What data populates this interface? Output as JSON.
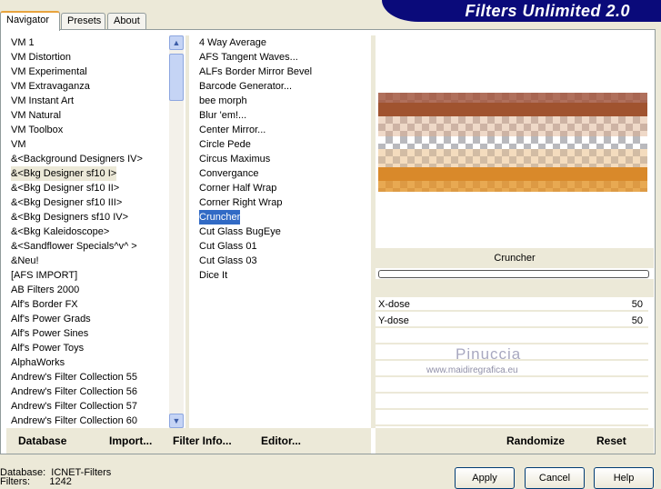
{
  "app": {
    "title": "Filters Unlimited 2.0"
  },
  "tabs": [
    {
      "label": "Navigator"
    },
    {
      "label": "Presets"
    },
    {
      "label": "About"
    }
  ],
  "categories": [
    "VM 1",
    "VM Distortion",
    "VM Experimental",
    "VM Extravaganza",
    "VM Instant Art",
    "VM Natural",
    "VM Toolbox",
    "VM",
    "&<Background Designers IV>",
    "&<Bkg Designer sf10 I>",
    "&<Bkg Designer sf10 II>",
    "&<Bkg Designer sf10 III>",
    "&<Bkg Designers sf10 IV>",
    "&<Bkg Kaleidoscope>",
    "&<Sandflower Specials^v^ >",
    "&Neu!",
    "[AFS IMPORT]",
    "AB Filters 2000",
    "Alf's Border FX",
    "Alf's Power Grads",
    "Alf's Power Sines",
    "Alf's Power Toys",
    "AlphaWorks",
    "Andrew's Filter Collection 55",
    "Andrew's Filter Collection 56",
    "Andrew's Filter Collection 57",
    "Andrew's Filter Collection 60"
  ],
  "selected_category_index": 9,
  "filters": [
    "4 Way Average",
    "AFS Tangent Waves...",
    "ALFs Border Mirror Bevel",
    "Barcode Generator...",
    "bee morph",
    "Blur 'em!...",
    "Center Mirror...",
    "Circle Pede",
    "Circus Maximus",
    "Convergance",
    "Corner Half Wrap",
    "Corner Right Wrap",
    "Cruncher",
    "Cut Glass  BugEye",
    "Cut Glass 01",
    "Cut Glass 03",
    "Dice It"
  ],
  "selected_filter_index": 12,
  "left_buttons": {
    "database": "Database",
    "import": "Import...",
    "filter_info": "Filter Info...",
    "editor": "Editor..."
  },
  "right_buttons": {
    "randomize": "Randomize",
    "reset": "Reset"
  },
  "filter_name": "Cruncher",
  "progress": 0,
  "params": [
    {
      "label": "X-dose",
      "value": "50"
    },
    {
      "label": "Y-dose",
      "value": "50"
    }
  ],
  "watermark": {
    "name": "Pinuccia",
    "url": "www.maidiregrafica.eu"
  },
  "status": {
    "database_label": "Database:",
    "database_value": "ICNET-Filters",
    "filters_label": "Filters:",
    "filters_value": "1242"
  },
  "dialog_buttons": {
    "apply": "Apply",
    "cancel": "Cancel",
    "help": "Help"
  }
}
